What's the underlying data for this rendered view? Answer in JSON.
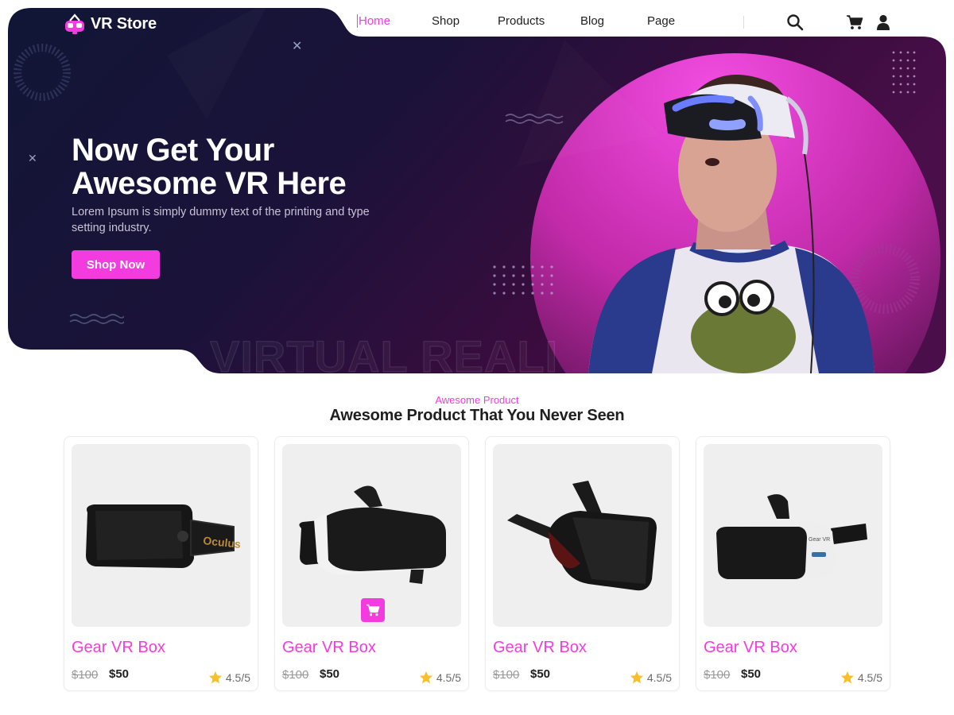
{
  "brand": {
    "name": "VR Store",
    "logo_icon": "vr-headset-logo-icon"
  },
  "nav": {
    "items": [
      {
        "label": "Home",
        "active": true
      },
      {
        "label": "Shop",
        "active": false
      },
      {
        "label": "Products",
        "active": false
      },
      {
        "label": "Blog",
        "active": false
      },
      {
        "label": "Page",
        "active": false
      }
    ],
    "icons": [
      "search-icon",
      "cart-icon",
      "user-icon"
    ]
  },
  "hero": {
    "title_line1": "Now Get Your",
    "title_line2": "Awesome VR Here",
    "subtitle": "Lorem Ipsum is simply dummy text of the printing and type setting industry.",
    "cta_label": "Shop Now",
    "watermark": "VIRTUAL REALI"
  },
  "section": {
    "kicker": "Awesome Product",
    "title": "Awesome Product That You Never Seen"
  },
  "products": [
    {
      "name": "Gear VR Box",
      "old_price": "$100",
      "price": "$50",
      "rating": "4.5/5",
      "image": "oculus-rift-headset"
    },
    {
      "name": "Gear VR Box",
      "old_price": "$100",
      "price": "$50",
      "rating": "4.5/5",
      "image": "gear-vr-headset",
      "cart_icon": "cart-icon"
    },
    {
      "name": "Gear VR Box",
      "old_price": "$100",
      "price": "$50",
      "rating": "4.5/5",
      "image": "black-vr-headset"
    },
    {
      "name": "Gear VR Box",
      "old_price": "$100",
      "price": "$50",
      "rating": "4.5/5",
      "image": "samsung-gear-vr-headset"
    }
  ],
  "colors": {
    "accent": "#f23ce0",
    "hero_dark": "#141938",
    "hero_purple": "#3a0c3e",
    "text_dark": "#1f1f1f"
  }
}
